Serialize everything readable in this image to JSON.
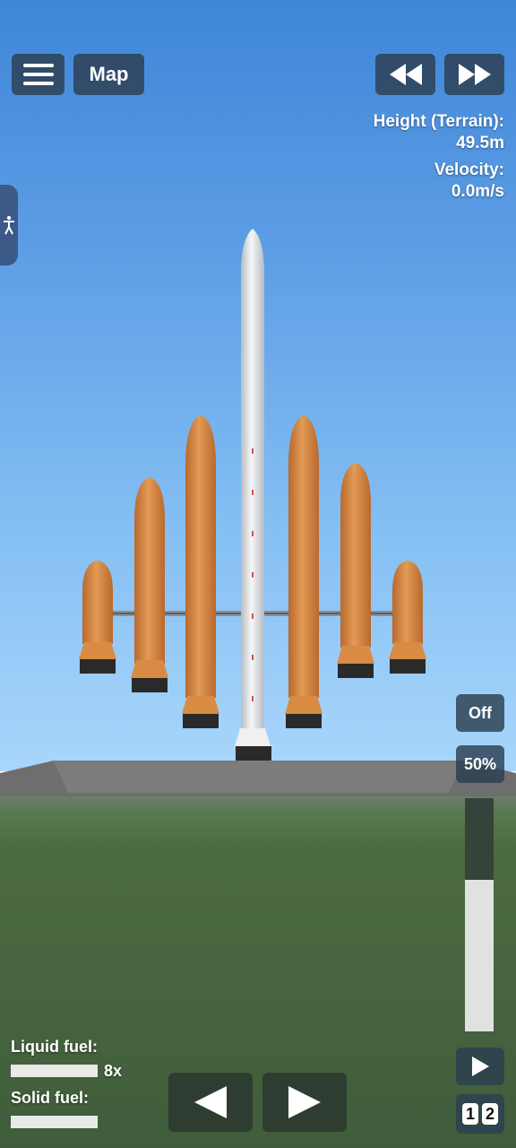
{
  "hud": {
    "map_label": "Map",
    "height_label": "Height (Terrain):",
    "height_value": "49.5m",
    "velocity_label": "Velocity:",
    "velocity_value": "0.0m/s"
  },
  "controls": {
    "off_label": "Off",
    "throttle_label": "50%",
    "throttle_level": 0.65,
    "stage_1": "1",
    "stage_2": "2"
  },
  "fuel": {
    "liquid_label": "Liquid fuel:",
    "liquid_multiplier": "8x",
    "solid_label": "Solid fuel:"
  },
  "icons": {
    "menu": "hamburger-icon",
    "rewind": "rewind-icon",
    "fast_forward": "fast-forward-icon",
    "accessibility": "accessibility-icon",
    "rotate_left": "triangle-left-icon",
    "rotate_right": "triangle-right-icon",
    "play": "play-icon"
  },
  "colors": {
    "button_bg": "#2c3e50",
    "booster": "#d98b43",
    "core": "#e9ecef",
    "sky_top": "#3f86d8",
    "ground": "#405d3b"
  }
}
